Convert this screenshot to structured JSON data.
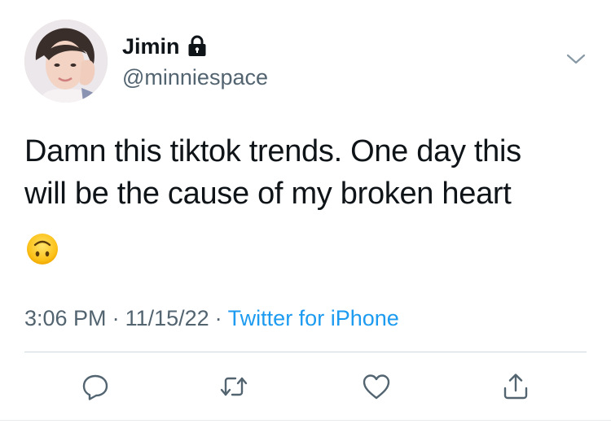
{
  "user": {
    "display_name": "Jimin",
    "handle": "@minniespace",
    "protected": true
  },
  "tweet": {
    "text_lines": [
      "Damn this tiktok trends. One day this",
      "will be the cause of my broken heart"
    ],
    "emoji": "upside-down-face"
  },
  "meta": {
    "time": "3:06 PM",
    "separator": "·",
    "date": "11/15/22",
    "source": "Twitter for iPhone"
  },
  "actions": [
    {
      "name": "reply",
      "icon": "reply-icon"
    },
    {
      "name": "retweet",
      "icon": "retweet-icon"
    },
    {
      "name": "like",
      "icon": "heart-icon"
    },
    {
      "name": "share",
      "icon": "share-icon"
    }
  ],
  "colors": {
    "text": "#0f1419",
    "secondary": "#536471",
    "link": "#1d9bf0",
    "divider": "#cfd9de"
  }
}
